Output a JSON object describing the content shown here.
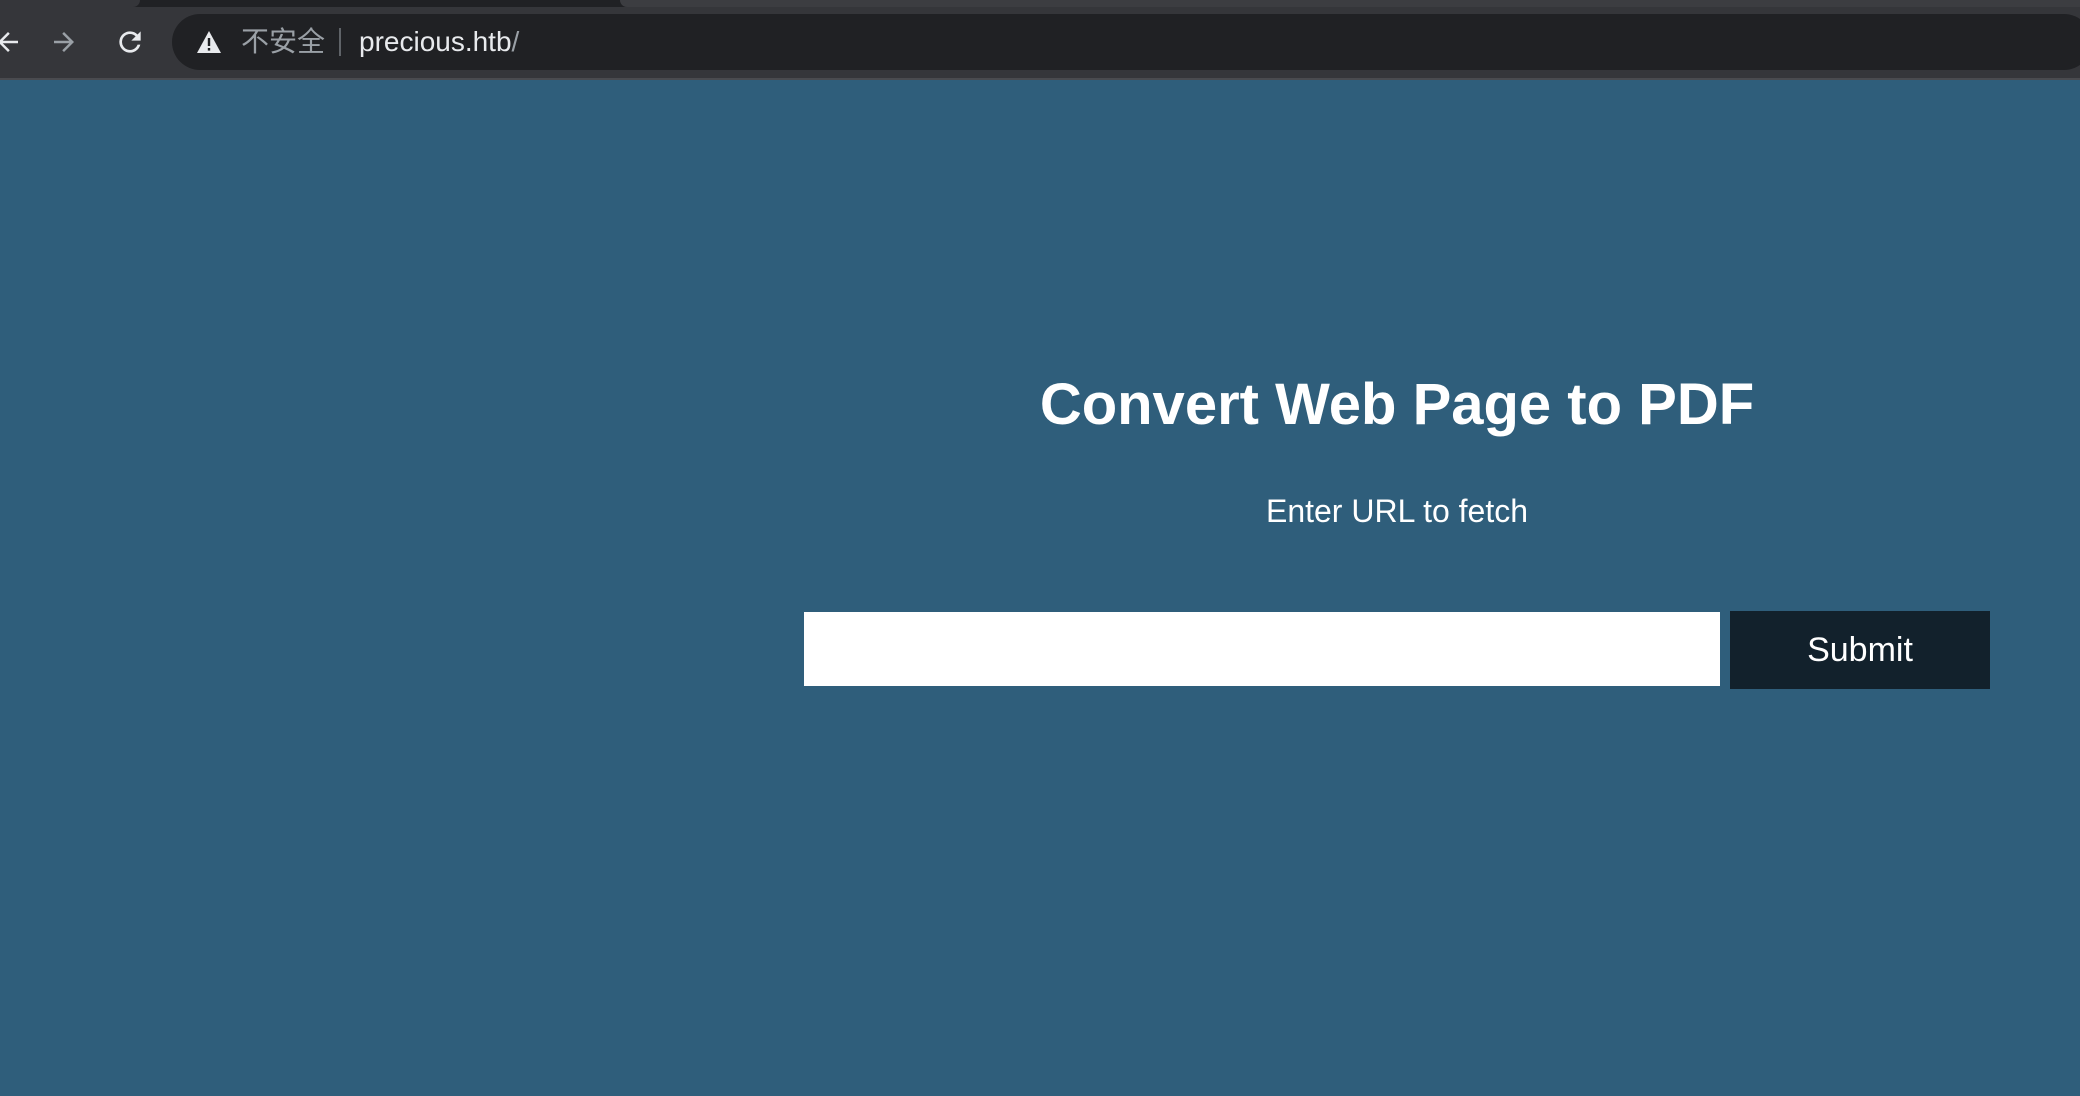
{
  "browser": {
    "security_label": "不安全",
    "url_host": "precious.htb",
    "url_path": "/",
    "icons": {
      "back": "arrow-left-icon",
      "forward": "arrow-right-icon",
      "reload": "reload-icon",
      "security": "warning-triangle-icon"
    },
    "colors": {
      "toolbar": "#35363a",
      "omnibox": "#202124",
      "icon": "#e8eaed",
      "icon_disabled": "#9aa0a6"
    }
  },
  "page": {
    "title": "Convert Web Page to PDF",
    "subtitle": "Enter URL to fetch",
    "url_input": {
      "value": "",
      "placeholder": ""
    },
    "submit_label": "Submit",
    "colors": {
      "background": "#2f5e7b",
      "text": "#ffffff",
      "button": "#12212c"
    }
  }
}
